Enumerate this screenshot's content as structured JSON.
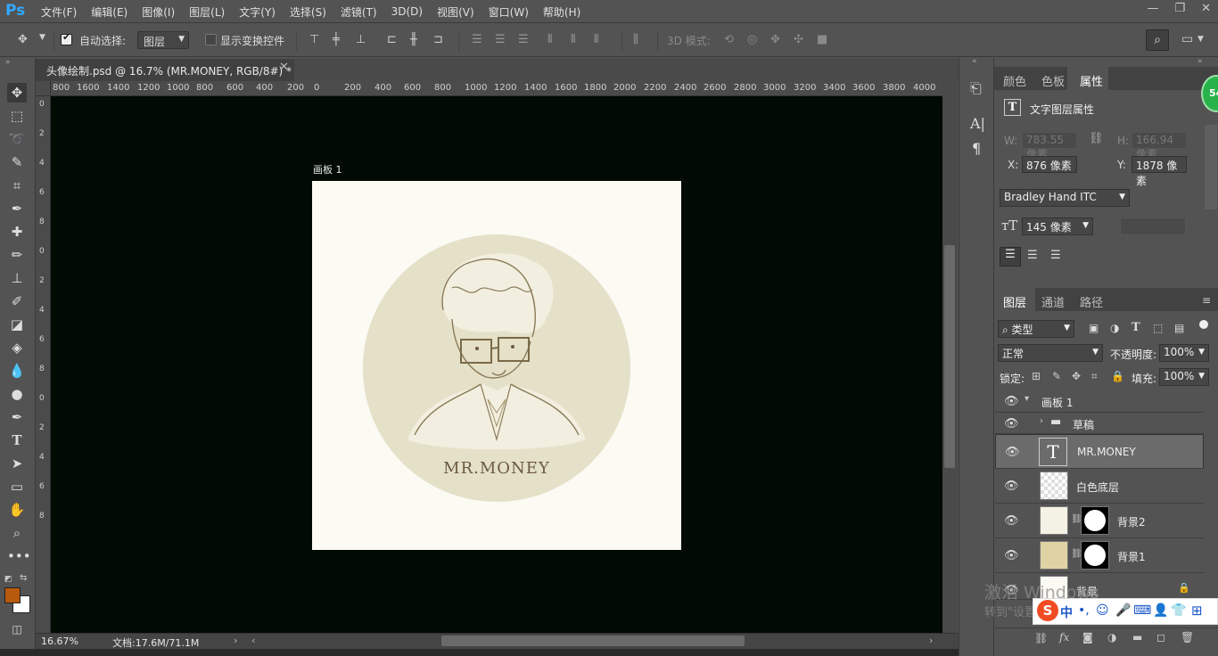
{
  "app": {
    "logo": "Ps",
    "window_buttons": [
      "—",
      "❐",
      "✕"
    ]
  },
  "menu": [
    "文件(F)",
    "编辑(E)",
    "图像(I)",
    "图层(L)",
    "文字(Y)",
    "选择(S)",
    "滤镜(T)",
    "3D(D)",
    "视图(V)",
    "窗口(W)",
    "帮助(H)"
  ],
  "options": {
    "auto_select_label": "自动选择:",
    "auto_select_value": "图层",
    "show_transform_label": "显示变换控件",
    "mode_3d_label": "3D 模式:"
  },
  "document": {
    "tab_title": "头像绘制.psd @ 16.7% (MR.MONEY, RGB/8#) *",
    "artboard_label": "画板 1",
    "artwork_text": "MR.MONEY",
    "zoom": "16.67%",
    "doc_size": "文档:17.6M/71.1M"
  },
  "rulers": {
    "top": [
      "800",
      "1600",
      "1400",
      "1200",
      "1000",
      "800",
      "600",
      "400",
      "200",
      "0",
      "200",
      "400",
      "600",
      "800",
      "1000",
      "1200",
      "1400",
      "1600",
      "1800",
      "2000",
      "2200",
      "2400",
      "2600",
      "2800",
      "3000",
      "3200",
      "3400",
      "3600",
      "3800",
      "4000"
    ],
    "left": [
      "0",
      "2",
      "4",
      "6",
      "8",
      "0",
      "2",
      "4",
      "6",
      "8",
      "0",
      "2",
      "4",
      "6",
      "8"
    ]
  },
  "panel_tabs": {
    "top": [
      "颜色",
      "色板",
      "属性"
    ],
    "layers": [
      "图层",
      "通道",
      "路径"
    ]
  },
  "properties": {
    "title": "文字图层属性",
    "w_label": "W:",
    "w_value": "783.55 像素",
    "h_label": "H:",
    "h_value": "166.94 像素",
    "x_label": "X:",
    "x_value": "876 像素",
    "y_label": "Y:",
    "y_value": "1878 像素",
    "font_family": "Bradley Hand ITC",
    "font_size": "145 像素"
  },
  "layers_panel": {
    "filter_label": "类型",
    "blend_mode": "正常",
    "opacity_label": "不透明度:",
    "opacity_value": "100%",
    "lock_label": "锁定:",
    "fill_label": "填充:",
    "fill_value": "100%",
    "layers": [
      {
        "name": "画板 1",
        "type": "artboard"
      },
      {
        "name": "草稿",
        "type": "group"
      },
      {
        "name": "MR.MONEY",
        "type": "text",
        "selected": true
      },
      {
        "name": "白色底层",
        "type": "pixel"
      },
      {
        "name": "背景2",
        "type": "masked"
      },
      {
        "name": "背景1",
        "type": "masked"
      },
      {
        "name": "背景",
        "type": "locked"
      }
    ]
  },
  "colors": {
    "foreground": "#b85a0e",
    "background": "#ffffff",
    "canvas": "#020a04",
    "artboard": "#fbfaf3",
    "circle": "#e5e0c8"
  },
  "overlay": {
    "watermark_line1": "激活 Windows",
    "watermark_line2": "转到\"设置\"以激活 Windows。",
    "ime_label": "中",
    "badge": "54"
  }
}
